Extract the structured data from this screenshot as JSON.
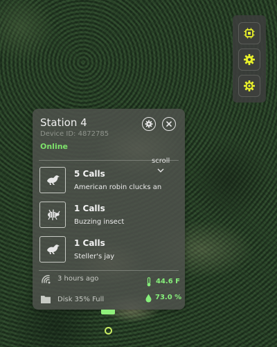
{
  "colors": {
    "accent_yellow": "#e8f02a",
    "online_green": "#7ee36b",
    "metric_green": "#86ef7a",
    "card_bg": "#4e524c"
  },
  "toolbar": {
    "items": [
      {
        "icon": "chip-icon"
      },
      {
        "icon": "gear-icon"
      },
      {
        "icon": "gear-outline-icon"
      }
    ]
  },
  "station": {
    "name": "Station 4",
    "device_id": "Device ID: 4872785",
    "status": "Online",
    "settings_icon": "gear-icon",
    "close_icon": "close-icon"
  },
  "calls": {
    "scroll_label": "scroll",
    "items": [
      {
        "count": "5 Calls",
        "description": "American robin clucks an",
        "icon": "bird-icon"
      },
      {
        "count": "1 Calls",
        "description": "Buzzing insect",
        "icon": "insect-icon"
      },
      {
        "count": "1 Calls",
        "description": "Steller's jay",
        "icon": "bird-icon"
      }
    ]
  },
  "footer": {
    "last_seen": "3 hours ago",
    "disk": "Disk 35% Full",
    "temperature": "44.6 F",
    "humidity": "73.0 %"
  }
}
